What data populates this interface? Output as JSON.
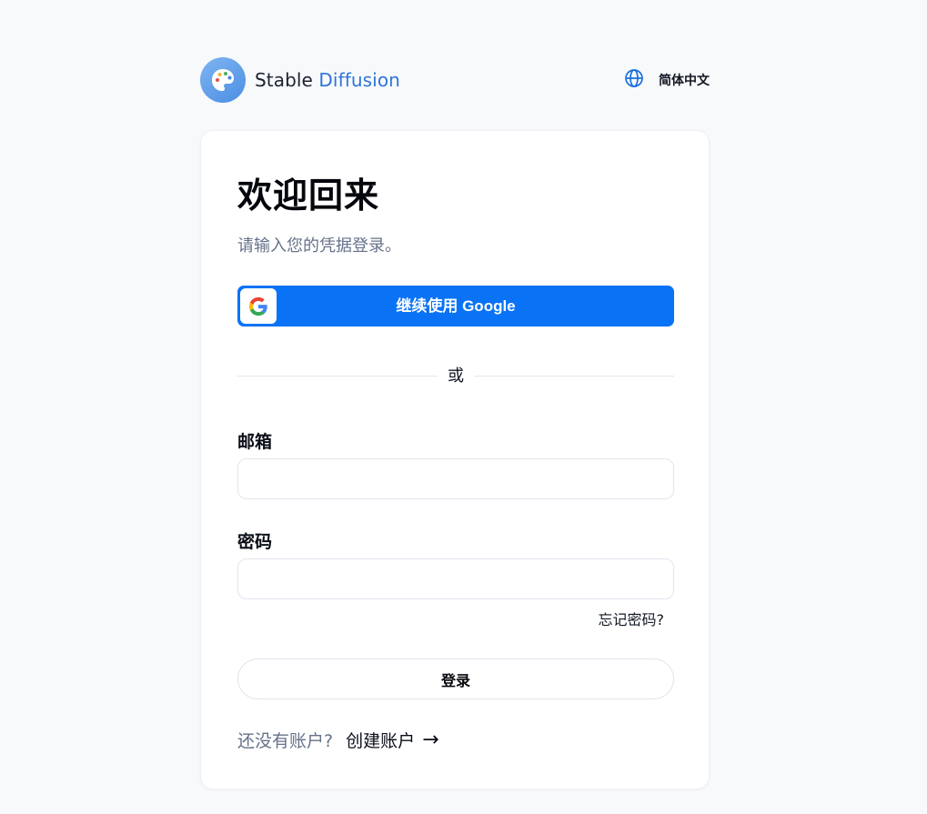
{
  "header": {
    "brand_part1": "Stable",
    "brand_part2": "Diffusion",
    "language_label": "简体中文",
    "logo_icon": "palette-icon",
    "language_icon": "globe-icon"
  },
  "login": {
    "title": "欢迎回来",
    "subtitle": "请输入您的凭据登录。",
    "google_button_label": "继续使用 Google",
    "google_icon": "google-icon",
    "divider_text": "或",
    "email_label": "邮箱",
    "email_value": "",
    "email_placeholder": "",
    "password_label": "密码",
    "password_value": "",
    "password_placeholder": "",
    "forgot_password": "忘记密码?",
    "submit_label": "登录",
    "signup_prompt": "还没有账户?",
    "signup_link": "创建账户",
    "signup_arrow": "→"
  },
  "colors": {
    "accent": "#0a73f5",
    "brand_accent": "#2f74d8",
    "page_background": "#f7f9fb",
    "muted_text": "#66728a"
  }
}
